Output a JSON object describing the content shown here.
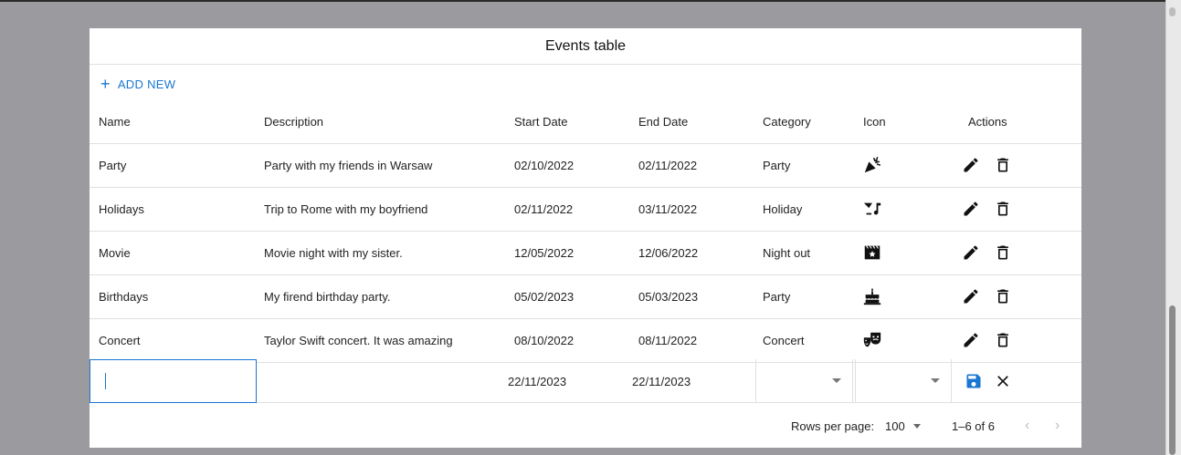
{
  "table": {
    "title": "Events table",
    "add_new_label": "ADD NEW",
    "columns": [
      "Name",
      "Description",
      "Start Date",
      "End Date",
      "Category",
      "Icon",
      "Actions"
    ],
    "rows": [
      {
        "name": "Party",
        "description": "Party with my friends in Warsaw",
        "start": "02/10/2022",
        "end": "02/11/2022",
        "category": "Party",
        "icon": "party-popper-icon"
      },
      {
        "name": "Holidays",
        "description": "Trip to Rome with my boyfriend",
        "start": "02/11/2022",
        "end": "03/11/2022",
        "category": "Holiday",
        "icon": "cocktail-music-icon"
      },
      {
        "name": "Movie",
        "description": "Movie night with my sister.",
        "start": "12/05/2022",
        "end": "12/06/2022",
        "category": "Night out",
        "icon": "movie-clapper-icon"
      },
      {
        "name": "Birthdays",
        "description": "My firend birthday party.",
        "start": "05/02/2023",
        "end": "05/03/2023",
        "category": "Party",
        "icon": "birthday-cake-icon"
      },
      {
        "name": "Concert",
        "description": "Taylor Swift concert. It was amazing",
        "start": "08/10/2022",
        "end": "08/11/2022",
        "category": "Concert",
        "icon": "theater-masks-icon"
      }
    ],
    "new_row": {
      "name": "",
      "description": "",
      "start": "22/11/2023",
      "end": "22/11/2023",
      "category": "",
      "icon": ""
    },
    "footer": {
      "rows_per_page_label": "Rows per page:",
      "rows_per_page_value": "100",
      "range": "1–6 of 6"
    }
  },
  "colors": {
    "accent": "#1976d2",
    "background": "#9b9b9f"
  }
}
